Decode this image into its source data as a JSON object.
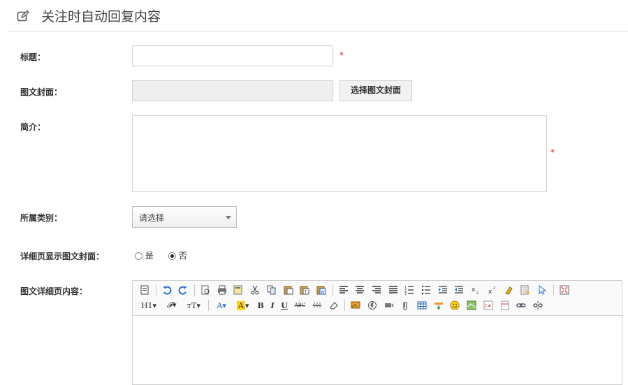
{
  "header": {
    "title": "关注时自动回复内容",
    "icon": "edit-icon"
  },
  "form": {
    "title_label": "标题：",
    "title_value": "",
    "required_mark": "*",
    "cover_label": "图文封面：",
    "cover_value": "",
    "cover_button": "选择图文封面",
    "intro_label": "简介：",
    "intro_value": "",
    "category_label": "所属类别：",
    "category_selected": "请选择",
    "show_cover_label": "详细页显示图文封面：",
    "show_cover_yes": "是",
    "show_cover_no": "否",
    "show_cover_selected": "否",
    "content_label": "图文详细页内容："
  },
  "editor": {
    "toolbar_row1": [
      "source",
      "undo",
      "redo",
      "preview",
      "print",
      "template",
      "cut",
      "copy",
      "paste",
      "paste-text",
      "paste-word",
      "paste-formatted",
      "align-left",
      "align-center",
      "align-right",
      "justify",
      "ordered-list",
      "unordered-list",
      "indent",
      "outdent",
      "subscript",
      "superscript",
      "clear-format",
      "select-all",
      "select",
      "fullscreen"
    ],
    "toolbar_row2": [
      "heading",
      "font-family",
      "font-size",
      "text-color",
      "highlight-color",
      "bold",
      "italic",
      "underline",
      "strikethrough",
      "horizontal-rule",
      "remove-format",
      "image",
      "flash",
      "media",
      "insert-file",
      "table",
      "page-break",
      "emoticon",
      "map",
      "code",
      "anchor",
      "link",
      "unlink"
    ],
    "heading_label": "H1",
    "bold_label": "B",
    "italic_label": "I",
    "underline_label": "U",
    "strike_label": "ABC"
  }
}
